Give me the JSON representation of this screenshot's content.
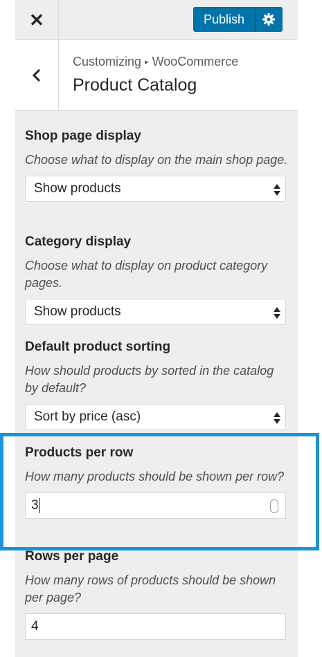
{
  "header": {
    "close_symbol": "✕",
    "publish_label": "Publish",
    "accent_color": "#0073aa"
  },
  "section": {
    "breadcrumb_parent": "Customizing",
    "breadcrumb_child": "WooCommerce",
    "breadcrumb_separator": "▸",
    "title": "Product Catalog"
  },
  "controls": {
    "shop_page_display": {
      "label": "Shop page display",
      "description": "Choose what to display on the main shop page.",
      "selected": "Show products"
    },
    "category_display": {
      "label": "Category display",
      "description": "Choose what to display on product category pages.",
      "selected": "Show products"
    },
    "default_sorting": {
      "label": "Default product sorting",
      "description": "How should products by sorted in the catalog by default?",
      "selected": "Sort by price (asc)"
    },
    "products_per_row": {
      "label": "Products per row",
      "description": "How many products should be shown per row?",
      "value": "3"
    },
    "rows_per_page": {
      "label": "Rows per page",
      "description": "How many rows of products should be shown per page?",
      "value": "4"
    }
  },
  "highlight_color": "#1a94d9"
}
